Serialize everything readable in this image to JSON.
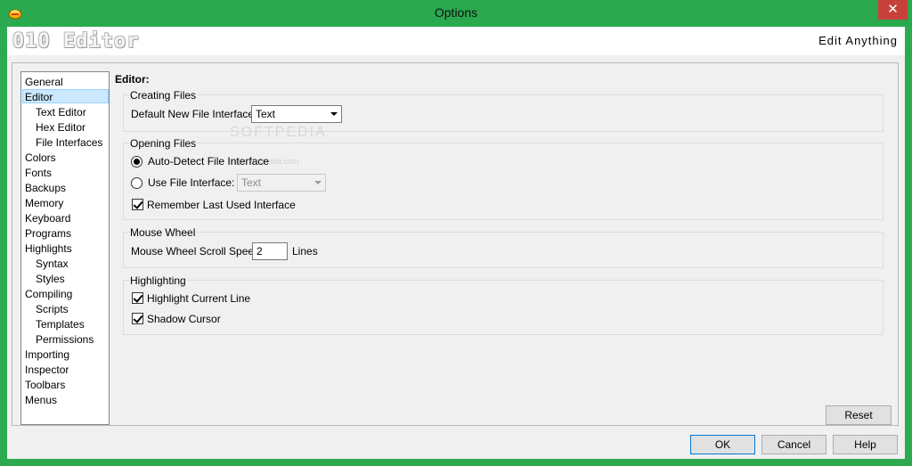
{
  "window": {
    "title": "Options",
    "close_glyph": "✕"
  },
  "banner": {
    "logo": "010 Editor",
    "tagline": "Edit Anything"
  },
  "tree": {
    "items": [
      {
        "label": "General"
      },
      {
        "label": "Editor"
      },
      {
        "label": "Text Editor"
      },
      {
        "label": "Hex Editor"
      },
      {
        "label": "File Interfaces"
      },
      {
        "label": "Colors"
      },
      {
        "label": "Fonts"
      },
      {
        "label": "Backups"
      },
      {
        "label": "Memory"
      },
      {
        "label": "Keyboard"
      },
      {
        "label": "Programs"
      },
      {
        "label": "Highlights"
      },
      {
        "label": "Syntax"
      },
      {
        "label": "Styles"
      },
      {
        "label": "Compiling"
      },
      {
        "label": "Scripts"
      },
      {
        "label": "Templates"
      },
      {
        "label": "Permissions"
      },
      {
        "label": "Importing"
      },
      {
        "label": "Inspector"
      },
      {
        "label": "Toolbars"
      },
      {
        "label": "Menus"
      }
    ],
    "selected": "Editor"
  },
  "editor": {
    "section_title": "Editor:",
    "creating_files": {
      "group_label": "Creating Files",
      "default_interface_label": "Default New File Interface:",
      "default_interface_value": "Text"
    },
    "opening_files": {
      "group_label": "Opening Files",
      "auto_detect_label": "Auto-Detect File Interface",
      "auto_detect_selected": true,
      "use_interface_label": "Use File Interface:",
      "use_interface_selected": false,
      "use_interface_value": "Text",
      "remember_label": "Remember Last Used Interface",
      "remember_checked": true
    },
    "mouse_wheel": {
      "group_label": "Mouse Wheel",
      "scroll_speed_label": "Mouse Wheel Scroll Speed:",
      "scroll_speed_value": "2",
      "scroll_speed_units": "Lines"
    },
    "highlighting": {
      "group_label": "Highlighting",
      "highlight_line_label": "Highlight Current Line",
      "highlight_line_checked": true,
      "shadow_cursor_label": "Shadow Cursor",
      "shadow_cursor_checked": true
    }
  },
  "buttons": {
    "reset": "Reset",
    "ok": "OK",
    "cancel": "Cancel",
    "help": "Help"
  },
  "watermark": {
    "text": "SOFTPEDIA",
    "url": "www.softpedia.com"
  },
  "colors": {
    "frame": "#2daa4f",
    "close": "#c7413a",
    "selection": "#cce8ff"
  }
}
